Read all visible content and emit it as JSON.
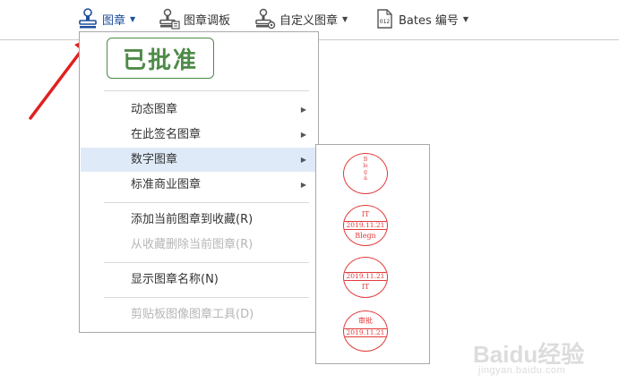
{
  "toolbar": {
    "stamp": {
      "label": "图章",
      "icon": "stamp-icon"
    },
    "palette": {
      "label": "图章调板",
      "icon": "stamp-palette-icon"
    },
    "custom": {
      "label": "自定义图章",
      "icon": "custom-stamp-icon"
    },
    "bates": {
      "label": "Bates 编号",
      "icon": "bates-number-icon",
      "icon_text": "012"
    }
  },
  "stamp_menu": {
    "preview_stamp": "已批准",
    "items": [
      {
        "label": "动态图章",
        "has_submenu": true
      },
      {
        "label": "在此签名图章",
        "has_submenu": true
      },
      {
        "label": "数字图章",
        "has_submenu": true,
        "highlighted": true
      },
      {
        "label": "标准商业图章",
        "has_submenu": true
      },
      {
        "label": "添加当前图章到收藏(R)",
        "enabled": true
      },
      {
        "label": "从收藏删除当前图章(R)",
        "enabled": false
      },
      {
        "label": "显示图章名称(N)",
        "enabled": true
      },
      {
        "label": "剪贴板图像图章工具(D)",
        "enabled": false
      }
    ]
  },
  "digital_stamps": [
    {
      "vertical_text": "Blegn"
    },
    {
      "top": "IT",
      "band": "2019.11.21",
      "bottom": "Blegn"
    },
    {
      "band": "2019.11.21",
      "bottom": "IT"
    },
    {
      "top": "审批",
      "band": "2019.11.21"
    }
  ],
  "colors": {
    "accent": "#1c4e9c",
    "highlight": "#dfeaf8",
    "stamp_green": "#4e8a48",
    "seal_red": "#e23a3a",
    "pointer_red": "#e02020"
  },
  "watermark": {
    "brand": "Baidu经验",
    "url": "jingyan.baidu.com"
  }
}
